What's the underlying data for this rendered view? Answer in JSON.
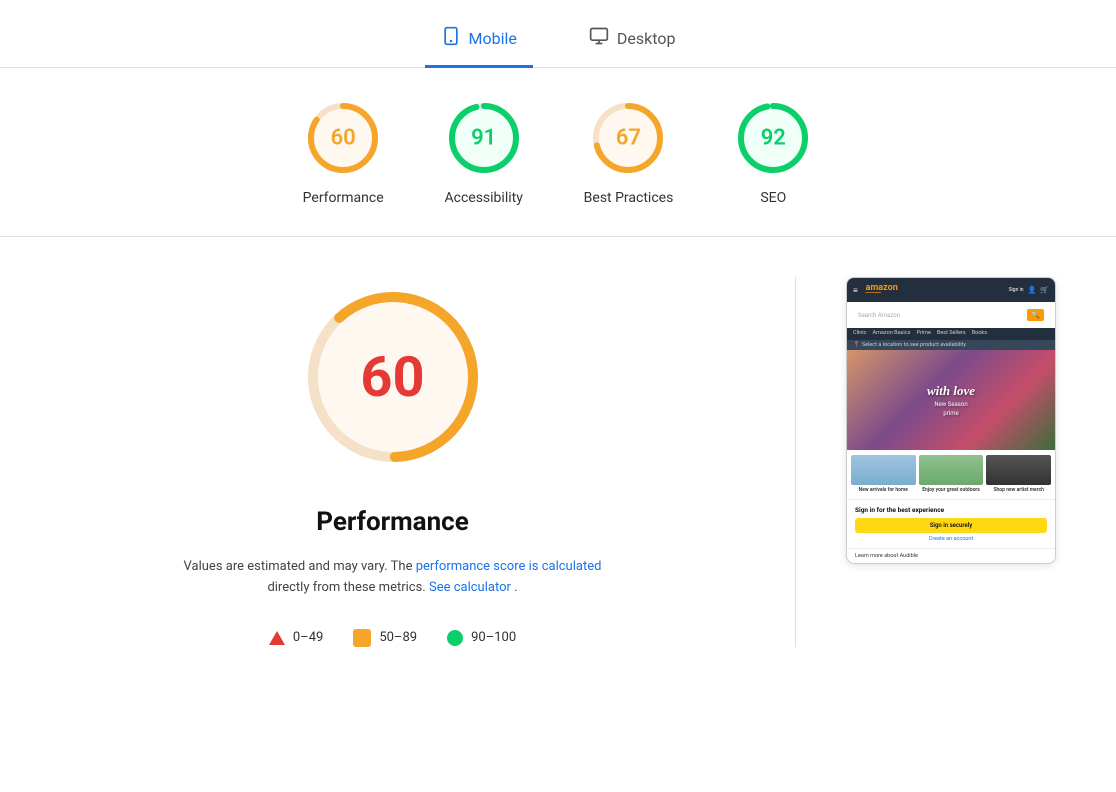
{
  "tabs": [
    {
      "id": "mobile",
      "label": "Mobile",
      "icon": "📱",
      "active": true
    },
    {
      "id": "desktop",
      "label": "Desktop",
      "icon": "🖥",
      "active": false
    }
  ],
  "scoreCards": [
    {
      "id": "performance",
      "label": "Performance",
      "score": 60,
      "color": "orange",
      "trackColor": "#f4a52a",
      "bgColor": "#fff8f0"
    },
    {
      "id": "accessibility",
      "label": "Accessibility",
      "score": 91,
      "color": "green",
      "trackColor": "#0cce6b",
      "bgColor": "#f0fff8"
    },
    {
      "id": "best-practices",
      "label": "Best Practices",
      "score": 67,
      "color": "orange",
      "trackColor": "#f4a52a",
      "bgColor": "#fff8f0"
    },
    {
      "id": "seo",
      "label": "SEO",
      "score": 92,
      "color": "green",
      "trackColor": "#0cce6b",
      "bgColor": "#f0fff8"
    }
  ],
  "mainScore": {
    "value": 60,
    "label": "Performance",
    "description": "Values are estimated and may vary. The ",
    "linkText1": "performance score is calculated",
    "linkText1End": " directly from these metrics. ",
    "linkText2": "See calculator",
    "linkText2End": "."
  },
  "legend": [
    {
      "id": "fail",
      "range": "0–49",
      "shape": "triangle",
      "color": "#e53935"
    },
    {
      "id": "average",
      "range": "50–89",
      "shape": "square",
      "color": "#f4a52a"
    },
    {
      "id": "pass",
      "range": "90–100",
      "shape": "circle",
      "color": "#0cce6b"
    }
  ],
  "phone": {
    "logoText": "amazon",
    "searchPlaceholder": "Search Amazon",
    "navItems": [
      "Clinic",
      "Amazon Basics",
      "Prime",
      "Best Sellers",
      "Books"
    ],
    "locationText": "Select a location to see product availability",
    "heroTitle": "with love",
    "heroSubtitle": "New Season prime",
    "categories": [
      {
        "label": "New arrivals for home",
        "colorClass": "blue"
      },
      {
        "label": "Enjoy your great outdoors",
        "colorClass": "green"
      },
      {
        "label": "Shop new artist merch",
        "colorClass": "dark"
      }
    ],
    "signinHeading": "Sign in for the best experience",
    "signinBtn": "Sign in securely",
    "createAccount": "Create an account",
    "audibleText": "Learn more about Audible"
  }
}
